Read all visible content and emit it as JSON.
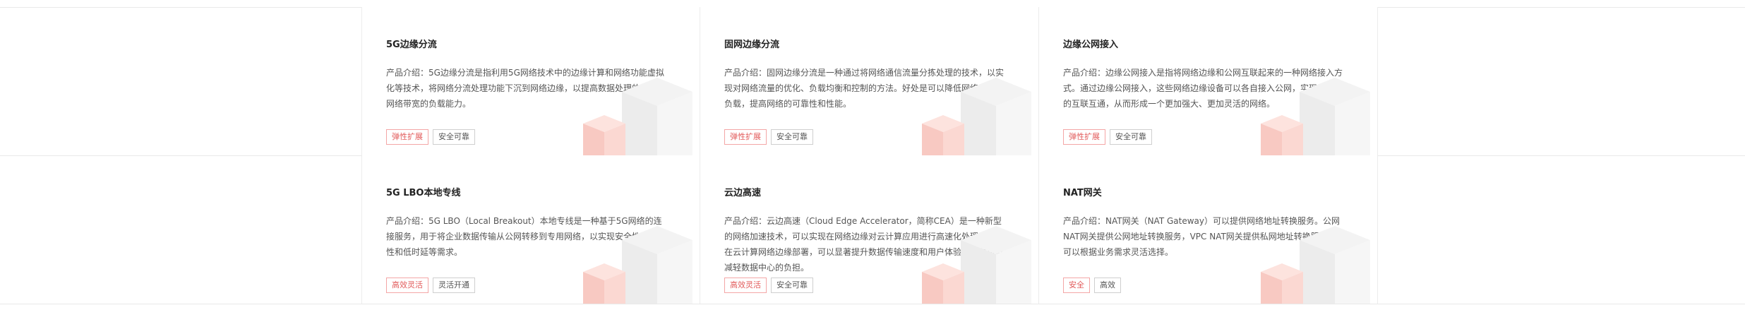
{
  "colors": {
    "accent_tag_text": "#e25b5b",
    "accent_tag_border": "#f4a6a6",
    "cube_pink": "#f8c9c2"
  },
  "cards": [
    {
      "title": "5G边缘分流",
      "desc": "产品介绍：5G边缘分流是指利用5G网络技术中的边缘计算和网络功能虚拟化等技术，将网络分流处理功能下沉到网络边缘，以提高数据处理的效率和网络带宽的负载能力。",
      "tags": [
        "弹性扩展",
        "安全可靠"
      ]
    },
    {
      "title": "固网边缘分流",
      "desc": "产品介绍：固网边缘分流是一种通过将网络通信流量分拣处理的技术，以实现对网络流量的优化、负载均衡和控制的方法。好处是可以降低网络中心的负载，提高网络的可靠性和性能。",
      "tags": [
        "弹性扩展",
        "安全可靠"
      ]
    },
    {
      "title": "边缘公网接入",
      "desc": "产品介绍：边缘公网接入是指将网络边缘和公网互联起来的一种网络接入方式。通过边缘公网接入，这些网络边缘设备可以各自接入公网，实现互联网的互联互通，从而形成一个更加强大、更加灵活的网络。",
      "tags": [
        "弹性扩展",
        "安全可靠"
      ]
    },
    {
      "title": "5G LBO本地专线",
      "desc": "产品介绍：5G LBO（Local Breakout）本地专线是一种基于5G网络的连接服务，用于将企业数据传输从公网转移到专用网络，以实现安全性、稳定性和低时延等需求。",
      "tags": [
        "高效灵活",
        "灵活开通"
      ]
    },
    {
      "title": "云边高速",
      "desc": "产品介绍：云边高速（Cloud Edge Accelerator，简称CEA）是一种新型的网络加速技术，可以实现在网络边缘对云计算应用进行高速化处理。通过在云计算网络边缘部署，可以显著提升数据传输速度和用户体验，同时可以减轻数据中心的负担。",
      "tags": [
        "高效灵活",
        "安全可靠"
      ]
    },
    {
      "title": "NAT网关",
      "desc": "产品介绍：NAT网关（NAT Gateway）可以提供网络地址转换服务。公网NAT网关提供公网地址转换服务，VPC NAT网关提供私网地址转换服务，您可以根据业务需求灵活选择。",
      "tags": [
        "安全",
        "高效"
      ]
    }
  ]
}
